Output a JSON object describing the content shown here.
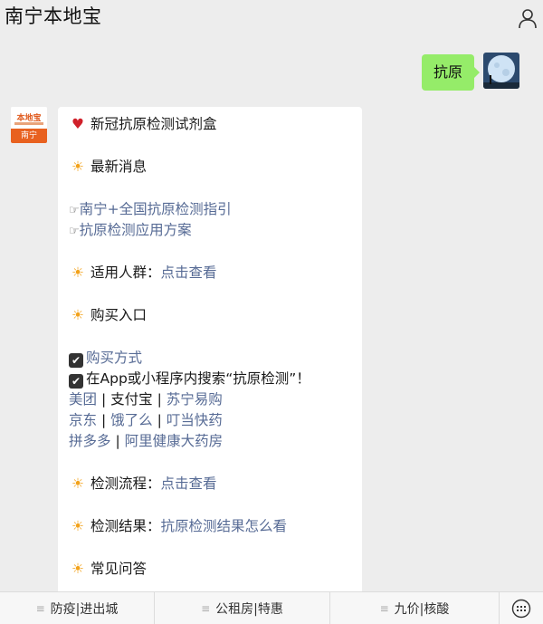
{
  "header": {
    "title": "南宁本地宝"
  },
  "chat": {
    "user_message": "抗原",
    "bot_avatar": {
      "top_text": "本地宝",
      "bottom_text": "南宁"
    },
    "reply": {
      "l1": "新冠抗原检测试剂盒",
      "l2": "最新消息",
      "l3": "南宁+全国抗原检测指引",
      "l4": "抗原检测应用方案",
      "l5_label": "适用人群：",
      "l5_link": "点击查看",
      "l6": "购买入口",
      "l7": "购买方式",
      "l8": "在App或小程序内搜索“抗原检测”！",
      "l9": {
        "a": "美团",
        "b": "支付宝",
        "c": "苏宁易购"
      },
      "l10": {
        "a": "京东",
        "b": "饿了么",
        "c": "叮当快药"
      },
      "l11": {
        "a": "拼多多",
        "b": "阿里健康大药房"
      },
      "sep": "|",
      "l12_label": "检测流程：",
      "l12_link": "点击查看",
      "l13_label": "检测结果：",
      "l13_link": "抗原检测结果怎么看",
      "l14": "常见问答"
    }
  },
  "menu": {
    "tab1": "防疫|进出城",
    "tab2": "公租房|特惠",
    "tab3": "九价|核酸"
  },
  "colors": {
    "link": "#576b95",
    "bubble_me": "#95ec69",
    "sun": "#f2a21b"
  }
}
